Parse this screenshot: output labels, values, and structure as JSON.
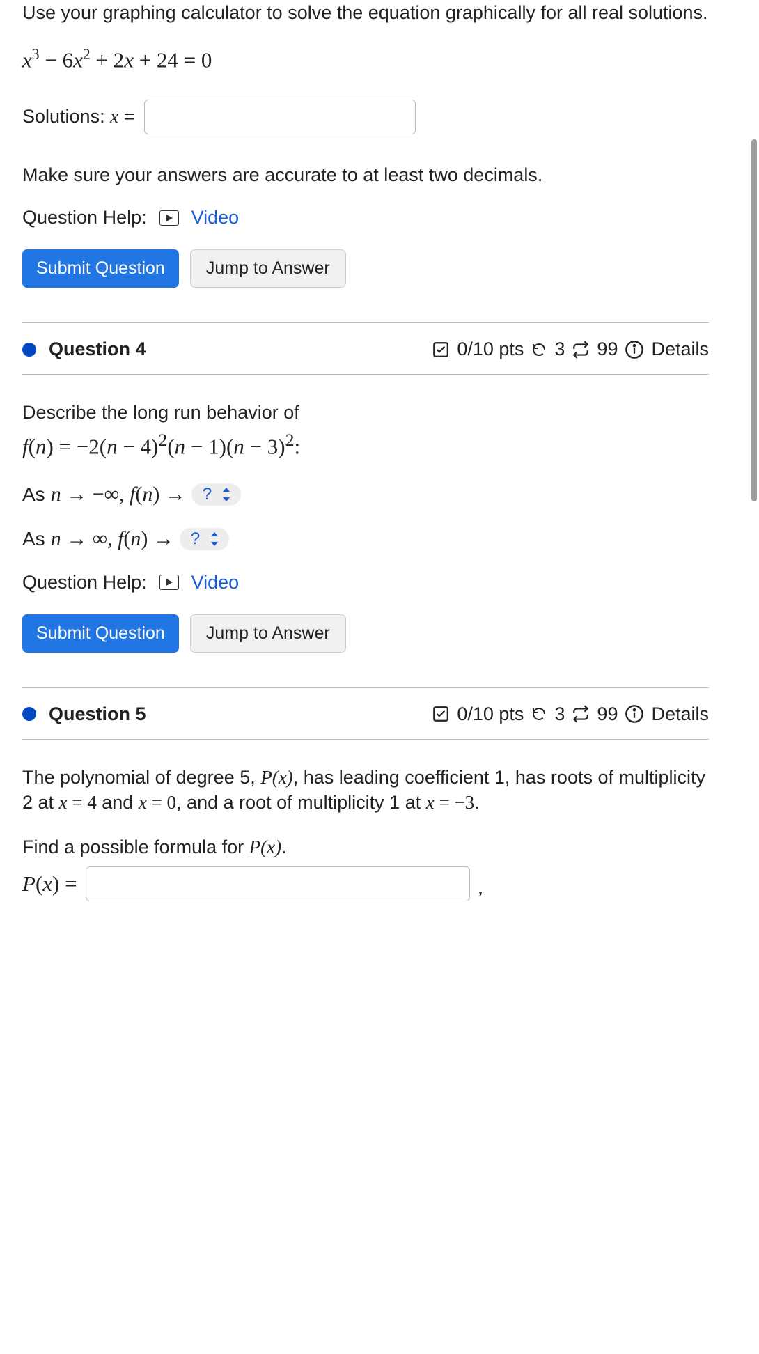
{
  "q3": {
    "prompt": "Use your graphing calculator to solve the equation graphically for all real solutions.",
    "equation_html": "x³ − 6x² + 2x + 24 = 0",
    "solutions_label_prefix": "Solutions: ",
    "solutions_var": "x",
    "solutions_eq": " =",
    "input_value": "",
    "note": "Make sure your answers are accurate to at least two decimals.",
    "help_label": "Question Help:",
    "video_label": "Video",
    "submit": "Submit Question",
    "jump": "Jump to Answer"
  },
  "q4header": {
    "title": "Question 4",
    "points": "0/10 pts",
    "tries": "3",
    "attempts": "99",
    "details": "Details"
  },
  "q4": {
    "prompt": "Describe the long run behavior of",
    "func_html": "f(n) = −2(n − 4)²(n − 1)(n − 3)²:",
    "row1_prefix": "As ",
    "row1_math": "n → −∞, f(n) →",
    "row2_prefix": "As ",
    "row2_math": "n → ∞, f(n) →",
    "dropdown_label": "?",
    "help_label": "Question Help:",
    "video_label": "Video",
    "submit": "Submit Question",
    "jump": "Jump to Answer"
  },
  "q5header": {
    "title": "Question 5",
    "points": "0/10 pts",
    "tries": "3",
    "attempts": "99",
    "details": "Details"
  },
  "q5": {
    "line1a": "The polynomial of degree 5, ",
    "line1b": "P(x)",
    "line1c": ", has leading coefficient 1, has roots of multiplicity 2 at ",
    "line1d": "x = 4",
    "line1e": " and ",
    "line1f": "x = 0",
    "line1g": ", and a root of multiplicity 1 at ",
    "line1h": "x = −3",
    "line1i": ".",
    "find_prefix": "Find a possible formula for ",
    "find_px": "P(x)",
    "find_suffix": ".",
    "px_label": "P(x) =",
    "input_value": "",
    "trailing_comma": ","
  }
}
